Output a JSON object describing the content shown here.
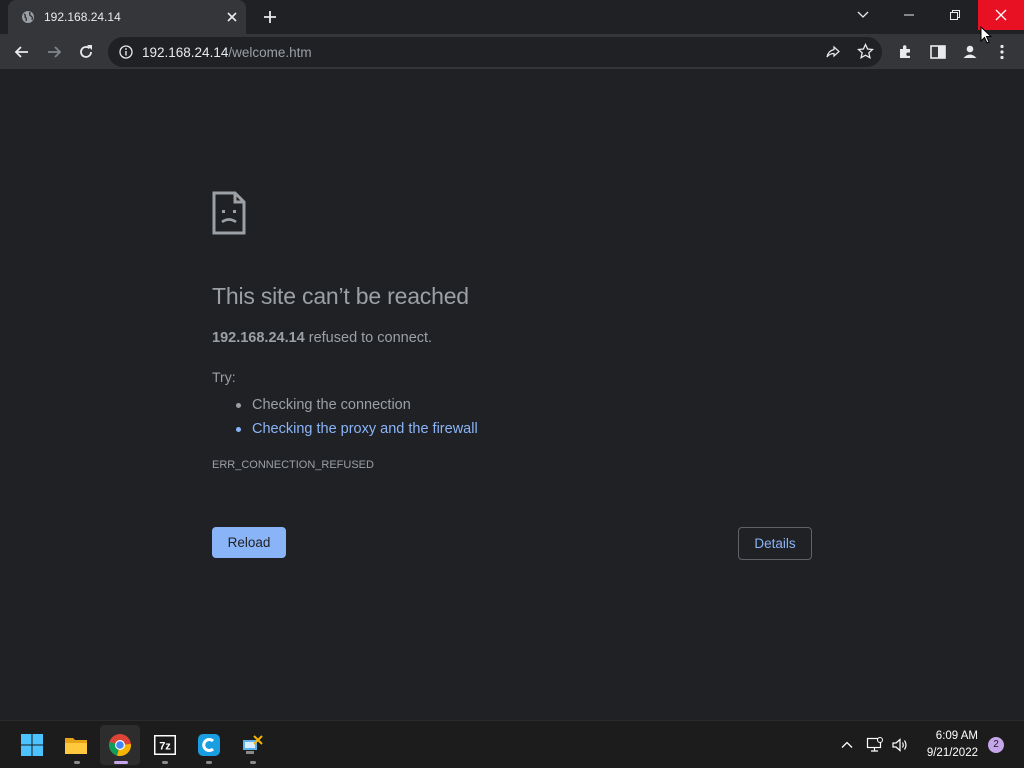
{
  "browser": {
    "tab": {
      "title": "192.168.24.14"
    },
    "url": {
      "host": "192.168.24.14",
      "path": "/welcome.htm"
    }
  },
  "error_page": {
    "title": "This site can’t be reached",
    "host": "192.168.24.14",
    "message": " refused to connect.",
    "try_label": "Try:",
    "suggestions": [
      "Checking the connection",
      "Checking the proxy and the firewall"
    ],
    "error_code": "ERR_CONNECTION_REFUSED",
    "reload_label": "Reload",
    "details_label": "Details"
  },
  "taskbar": {
    "time": "6:09 AM",
    "date": "9/21/2022",
    "notification_count": "2",
    "apps": [
      "start-icon",
      "file-explorer-icon",
      "chrome-icon",
      "7zip-icon",
      "ccleaner-icon",
      "network-tool-icon"
    ]
  },
  "colors": {
    "page_bg": "#202124",
    "toolbar_bg": "#35363a",
    "link": "#8ab4f8",
    "text": "#9aa0a6",
    "close_red": "#e81123"
  }
}
